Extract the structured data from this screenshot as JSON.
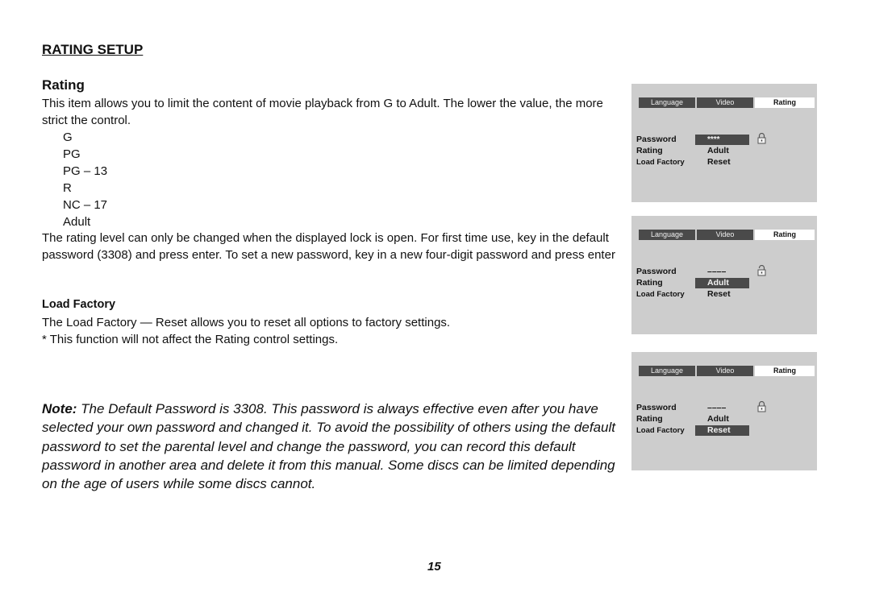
{
  "section_title": "RATING SETUP",
  "rating": {
    "heading": "Rating",
    "intro": "This item allows you to limit the content of movie playback from G to Adult. The lower the value, the more strict the control.",
    "levels": [
      "G",
      "PG",
      "PG – 13",
      "R",
      "NC – 17",
      "Adult"
    ],
    "lock_text": "The rating level can only be changed when the displayed lock is open. For first time use, key in the default password (3308) and press enter. To set a new password, key in a new four-digit password and press enter"
  },
  "load_factory": {
    "heading": "Load Factory",
    "line1": "The Load Factory — Reset allows you to reset all options to factory settings.",
    "line2": "* This function will not affect the Rating control settings."
  },
  "note": {
    "label": "Note:",
    "text": " The Default Password is 3308. This password is always effective even after you have selected your own password and changed it. To avoid  the possibility of others using the default password to set the parental level and change the password, you can record this default password in another area  and delete it from this manual. Some discs can be limited depending on the age of users while some discs cannot."
  },
  "page_number": "15",
  "screens": [
    {
      "tabs": [
        "Language",
        "Video",
        "Rating"
      ],
      "active_tab": "Rating",
      "rows": [
        {
          "label": "Password",
          "value": "****",
          "highlighted": true
        },
        {
          "label": "Rating",
          "value": "Adult",
          "highlighted": false
        },
        {
          "label": "Load Factory",
          "value": "Reset",
          "highlighted": false
        }
      ],
      "lock_state": "locked"
    },
    {
      "tabs": [
        "Language",
        "Video",
        "Rating"
      ],
      "active_tab": "Rating",
      "rows": [
        {
          "label": "Password",
          "value": "––––",
          "highlighted": false
        },
        {
          "label": "Rating",
          "value": "Adult",
          "highlighted": true
        },
        {
          "label": "Load Factory",
          "value": "Reset",
          "highlighted": false
        }
      ],
      "lock_state": "unlocked"
    },
    {
      "tabs": [
        "Language",
        "Video",
        "Rating"
      ],
      "active_tab": "Rating",
      "rows": [
        {
          "label": "Password",
          "value": "––––",
          "highlighted": false
        },
        {
          "label": "Rating",
          "value": "Adult",
          "highlighted": false
        },
        {
          "label": "Load Factory",
          "value": "Reset",
          "highlighted": true
        }
      ],
      "lock_state": "locked"
    }
  ]
}
